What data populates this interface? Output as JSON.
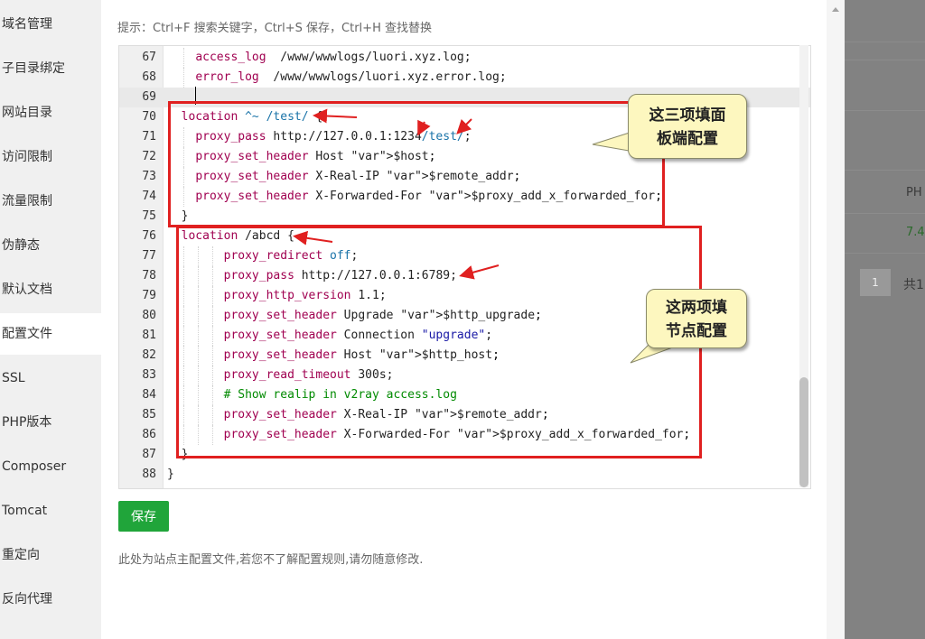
{
  "sidebar": {
    "items": [
      {
        "label": "域名管理"
      },
      {
        "label": "子目录绑定"
      },
      {
        "label": "网站目录"
      },
      {
        "label": "访问限制"
      },
      {
        "label": "流量限制"
      },
      {
        "label": "伪静态"
      },
      {
        "label": "默认文档"
      },
      {
        "label": "配置文件"
      },
      {
        "label": "SSL"
      },
      {
        "label": "PHP版本"
      },
      {
        "label": "Composer"
      },
      {
        "label": "Tomcat"
      },
      {
        "label": "重定向"
      },
      {
        "label": "反向代理"
      }
    ],
    "active": "配置文件"
  },
  "editor": {
    "hint": "提示：Ctrl+F 搜索关键字，Ctrl+S 保存，Ctrl+H 查找替换",
    "lines": [
      {
        "n": "67",
        "code": "    access_log  /www/wwwlogs/luori.xyz.log;"
      },
      {
        "n": "68",
        "code": "    error_log  /www/wwwlogs/luori.xyz.error.log;"
      },
      {
        "n": "69",
        "code": ""
      },
      {
        "n": "70",
        "code": "  location ^~ /test/ {"
      },
      {
        "n": "71",
        "code": "    proxy_pass http://127.0.0.1:1234/test/;"
      },
      {
        "n": "72",
        "code": "    proxy_set_header Host $host;"
      },
      {
        "n": "73",
        "code": "    proxy_set_header X-Real-IP $remote_addr;"
      },
      {
        "n": "74",
        "code": "    proxy_set_header X-Forwarded-For $proxy_add_x_forwarded_for;"
      },
      {
        "n": "75",
        "code": "  }"
      },
      {
        "n": "76",
        "code": "  location /abcd {"
      },
      {
        "n": "77",
        "code": "        proxy_redirect off;"
      },
      {
        "n": "78",
        "code": "        proxy_pass http://127.0.0.1:6789;"
      },
      {
        "n": "79",
        "code": "        proxy_http_version 1.1;"
      },
      {
        "n": "80",
        "code": "        proxy_set_header Upgrade $http_upgrade;"
      },
      {
        "n": "81",
        "code": "        proxy_set_header Connection \"upgrade\";"
      },
      {
        "n": "82",
        "code": "        proxy_set_header Host $http_host;"
      },
      {
        "n": "83",
        "code": "        proxy_read_timeout 300s;"
      },
      {
        "n": "84",
        "code": "        # Show realip in v2ray access.log"
      },
      {
        "n": "85",
        "code": "        proxy_set_header X-Real-IP $remote_addr;"
      },
      {
        "n": "86",
        "code": "        proxy_set_header X-Forwarded-For $proxy_add_x_forwarded_for;"
      },
      {
        "n": "87",
        "code": "  }"
      },
      {
        "n": "88",
        "code": "}"
      }
    ]
  },
  "actions": {
    "save_label": "保存",
    "note": "此处为站点主配置文件,若您不了解配置规则,请勿随意修改."
  },
  "annotations": {
    "callout1": [
      "这三项填面",
      "板端配置"
    ],
    "callout2": [
      "这两项填",
      "节点配置"
    ],
    "color": "#e02020"
  },
  "background": {
    "col_header": "PH",
    "cell_value": "7.4",
    "page_num": "1",
    "page_total": "共1"
  },
  "colors": {
    "accent": "#20a53a",
    "keyword": "#a00050",
    "variable": "#1a73a8"
  }
}
